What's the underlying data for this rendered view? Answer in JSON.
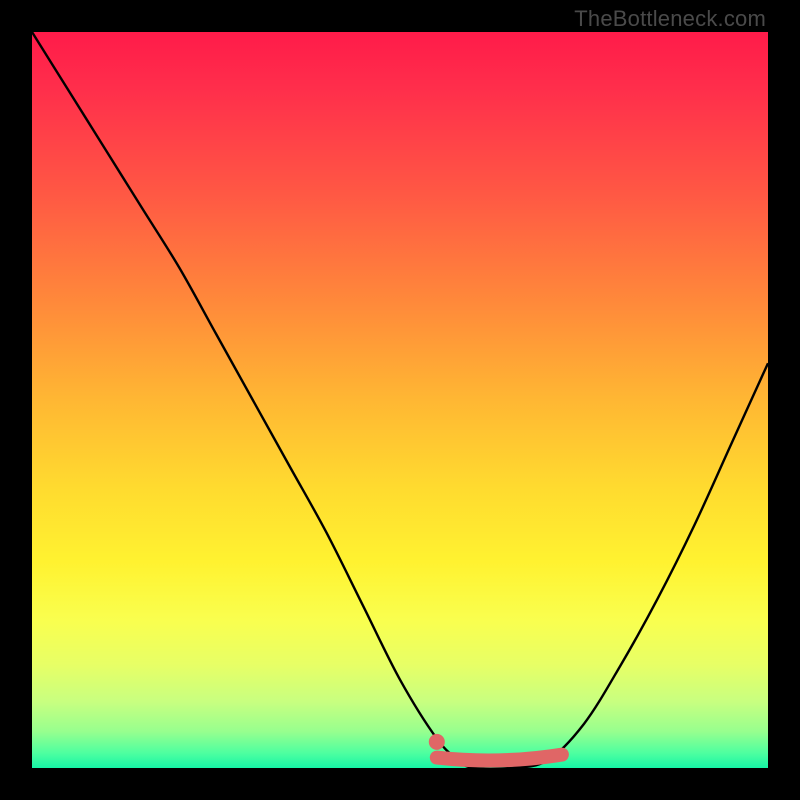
{
  "watermark": "TheBottleneck.com",
  "colors": {
    "background": "#000000",
    "curve": "#000000",
    "marker_stroke": "#e06666",
    "marker_fill": "#e06666",
    "gradient_top": "#ff1b4a",
    "gradient_bottom": "#16f5a6"
  },
  "chart_data": {
    "type": "line",
    "title": "",
    "xlabel": "",
    "ylabel": "",
    "xlim": [
      0,
      100
    ],
    "ylim": [
      0,
      100
    ],
    "grid": false,
    "legend": false,
    "series": [
      {
        "name": "bottleneck-curve",
        "x": [
          0,
          5,
          10,
          15,
          20,
          25,
          30,
          35,
          40,
          45,
          50,
          55,
          58,
          60,
          65,
          70,
          75,
          80,
          85,
          90,
          95,
          100
        ],
        "values": [
          100,
          92,
          84,
          76,
          68,
          59,
          50,
          41,
          32,
          22,
          12,
          4,
          1,
          0,
          0,
          1,
          6,
          14,
          23,
          33,
          44,
          55
        ]
      }
    ],
    "highlight_region": {
      "name": "optimal-range",
      "x_start": 55,
      "x_end": 72,
      "y": 1
    },
    "marker": {
      "name": "selected-point",
      "x": 55,
      "y": 3
    }
  }
}
